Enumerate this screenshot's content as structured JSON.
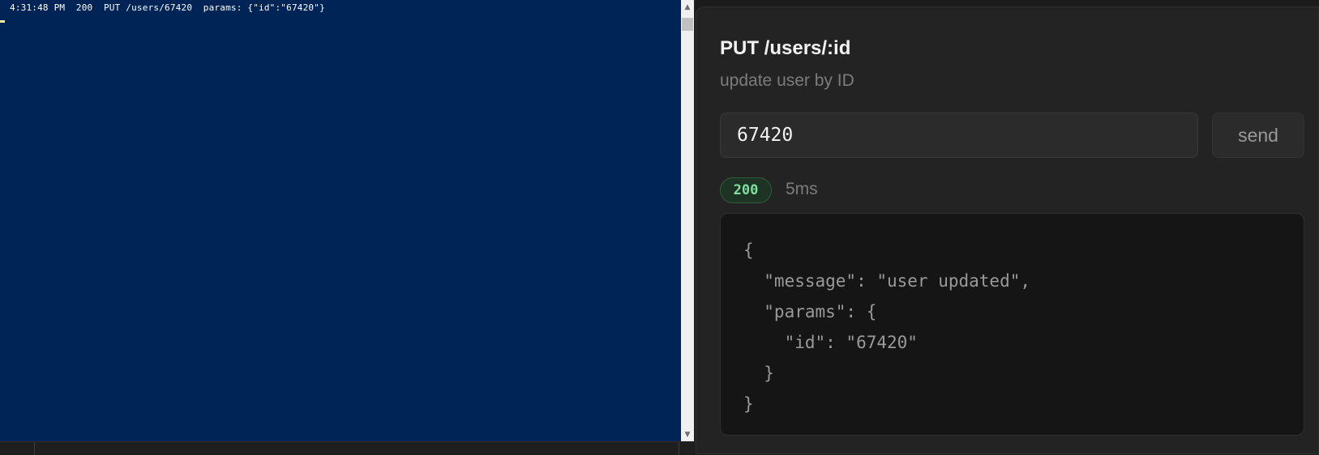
{
  "terminal": {
    "log_line": "4:31:48 PM  200  PUT /users/67420  params: {\"id\":\"67420\"}",
    "background": "#012456",
    "scroll_up_icon": "triangle-up-icon",
    "scroll_down_icon": "triangle-down-icon"
  },
  "panel": {
    "title": "PUT /users/:id",
    "description": "update user by ID",
    "id_input_value": "67420",
    "send_label": "send",
    "status_code": "200",
    "status_color": "#7fe0a0",
    "response_time": "5ms",
    "response_body": "{\n  \"message\": \"user updated\",\n  \"params\": {\n    \"id\": \"67420\"\n  }\n}"
  }
}
